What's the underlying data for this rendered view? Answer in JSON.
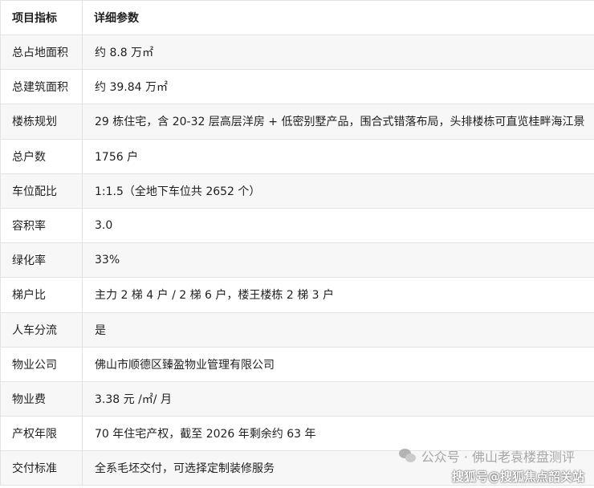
{
  "table": {
    "headers": [
      "项目指标",
      "详细参数"
    ],
    "rows": [
      {
        "label": "总占地面积",
        "value": "约 8.8 万㎡"
      },
      {
        "label": "总建筑面积",
        "value": "约 39.84 万㎡"
      },
      {
        "label": "楼栋规划",
        "value": "29 栋住宅，含 20-32 层高层洋房 + 低密别墅产品，围合式错落布局，头排楼栋可直览桂畔海江景"
      },
      {
        "label": "总户数",
        "value": "1756 户"
      },
      {
        "label": "车位配比",
        "value": "1:1.5（全地下车位共 2652 个）"
      },
      {
        "label": "容积率",
        "value": "3.0"
      },
      {
        "label": "绿化率",
        "value": "33%"
      },
      {
        "label": "梯户比",
        "value": "主力 2 梯 4 户 / 2 梯 6 户，楼王楼栋 2 梯 3 户"
      },
      {
        "label": "人车分流",
        "value": "是"
      },
      {
        "label": "物业公司",
        "value": "佛山市顺德区臻盈物业管理有限公司"
      },
      {
        "label": "物业费",
        "value": "3.38 元 /㎡/ 月"
      },
      {
        "label": "产权年限",
        "value": "70 年住宅产权，截至 2026 年剩余约 63 年"
      },
      {
        "label": "交付标准",
        "value": "全系毛坯交付，可选择定制装修服务"
      }
    ]
  },
  "watermark": {
    "line1": "公众号 · 佛山老袁楼盘测评",
    "line2": "搜狐号@搜狐焦点韶关站"
  }
}
